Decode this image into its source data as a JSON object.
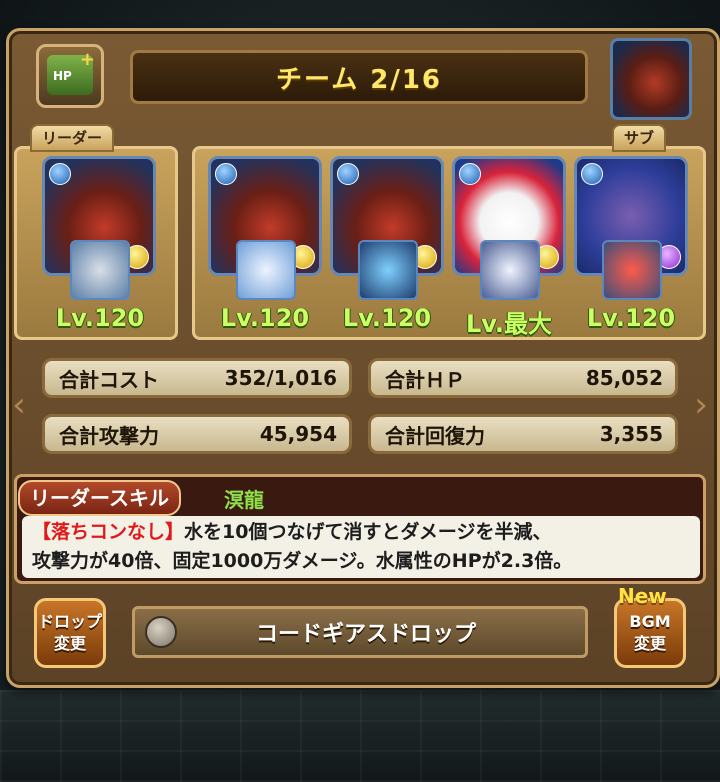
{
  "header": {
    "team_title": "チーム 2/16",
    "hp_button_label": "HP",
    "hp_button_plus": "+"
  },
  "labels": {
    "leader": "リーダー",
    "sub": "サブ"
  },
  "team": [
    {
      "role": "leader",
      "level": "Lv.120",
      "attribute": "water",
      "sub_attribute": "light"
    },
    {
      "role": "sub",
      "level": "Lv.120",
      "attribute": "water",
      "sub_attribute": "light"
    },
    {
      "role": "sub",
      "level": "Lv.120",
      "attribute": "water",
      "sub_attribute": "light"
    },
    {
      "role": "sub",
      "level": "Lv.最大",
      "attribute": "water",
      "sub_attribute": "light"
    },
    {
      "role": "sub",
      "level": "Lv.120",
      "attribute": "water",
      "sub_attribute": "dark"
    }
  ],
  "stats": {
    "cost_label": "合計コスト",
    "cost_value": "352/1,016",
    "hp_label": "合計ＨＰ",
    "hp_value": "85,052",
    "atk_label": "合計攻撃力",
    "atk_value": "45,954",
    "rcv_label": "合計回復力",
    "rcv_value": "3,355"
  },
  "leader_skill": {
    "label": "リーダースキル",
    "name": "溟龍",
    "tag": "【落ちコンなし】",
    "line1": "水を10個つなげて消すとダメージを半減、",
    "line2": "攻撃力が40倍、固定1000万ダメージ。水属性のHPが2.3倍。"
  },
  "bottom": {
    "drop_button_line1": "ドロップ",
    "drop_button_line2": "変更",
    "drop_skin_name": "コードギアスドロップ",
    "bgm_new_badge": "New",
    "bgm_button_line1": "BGM",
    "bgm_button_line2": "変更"
  },
  "colors": {
    "level_text": "#ccff66",
    "team_title": "#ffe76a",
    "skill_name": "#8fe04a",
    "skill_tag": "#e01a1a"
  }
}
